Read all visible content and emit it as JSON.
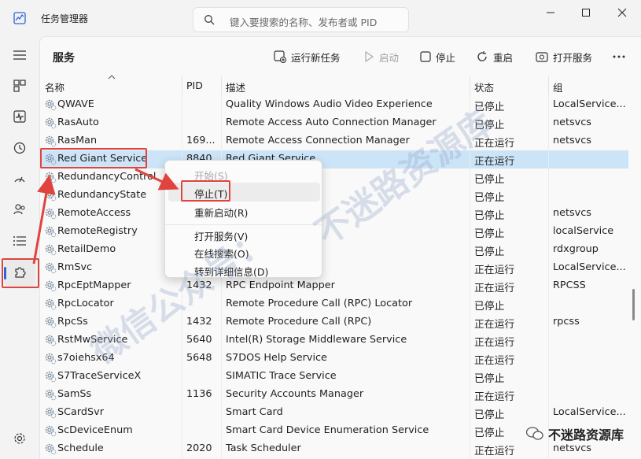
{
  "window": {
    "title": "任务管理器",
    "search_placeholder": "键入要搜索的名称、发布者或 PID"
  },
  "toolbar": {
    "page_title": "服务",
    "run_new_task": "运行新任务",
    "start": "启动",
    "stop": "停止",
    "restart": "重启",
    "open_services": "打开服务"
  },
  "columns": {
    "name": "名称",
    "pid": "PID",
    "description": "描述",
    "status": "状态",
    "group": "组"
  },
  "rows": [
    {
      "name": "QWAVE",
      "pid": "",
      "desc": "Quality Windows Audio Video Experience",
      "status": "已停止",
      "group": "LocalService..."
    },
    {
      "name": "RasAuto",
      "pid": "",
      "desc": "Remote Access Auto Connection Manager",
      "status": "已停止",
      "group": "netsvcs"
    },
    {
      "name": "RasMan",
      "pid": "169...",
      "desc": "Remote Access Connection Manager",
      "status": "正在运行",
      "group": "netsvcs"
    },
    {
      "name": "Red Giant Service",
      "pid": "8840",
      "desc": "Red Giant Service",
      "status": "正在运行",
      "group": ""
    },
    {
      "name": "RedundancyControl",
      "pid": "",
      "desc": "",
      "status": "已停止",
      "group": ""
    },
    {
      "name": "RedundancyState",
      "pid": "",
      "desc": "",
      "status": "已停止",
      "group": ""
    },
    {
      "name": "RemoteAccess",
      "pid": "",
      "desc": "e Access",
      "status": "已停止",
      "group": "netsvcs"
    },
    {
      "name": "RemoteRegistry",
      "pid": "",
      "desc": "",
      "status": "已停止",
      "group": "localService"
    },
    {
      "name": "RetailDemo",
      "pid": "",
      "desc": "",
      "status": "已停止",
      "group": "rdxgroup"
    },
    {
      "name": "RmSvc",
      "pid": "",
      "desc": "",
      "status": "正在运行",
      "group": "LocalService..."
    },
    {
      "name": "RpcEptMapper",
      "pid": "1432",
      "desc": "RPC Endpoint Mapper",
      "status": "正在运行",
      "group": "RPCSS"
    },
    {
      "name": "RpcLocator",
      "pid": "",
      "desc": "Remote Procedure Call (RPC) Locator",
      "status": "已停止",
      "group": ""
    },
    {
      "name": "RpcSs",
      "pid": "1432",
      "desc": "Remote Procedure Call (RPC)",
      "status": "正在运行",
      "group": "rpcss"
    },
    {
      "name": "RstMwService",
      "pid": "5640",
      "desc": "Intel(R) Storage Middleware Service",
      "status": "正在运行",
      "group": ""
    },
    {
      "name": "s7oiehsx64",
      "pid": "5648",
      "desc": "S7DOS Help Service",
      "status": "正在运行",
      "group": ""
    },
    {
      "name": "S7TraceServiceX",
      "pid": "",
      "desc": "SIMATIC Trace Service",
      "status": "已停止",
      "group": ""
    },
    {
      "name": "SamSs",
      "pid": "1136",
      "desc": "Security Accounts Manager",
      "status": "正在运行",
      "group": ""
    },
    {
      "name": "SCardSvr",
      "pid": "",
      "desc": "Smart Card",
      "status": "已停止",
      "group": "LocalService..."
    },
    {
      "name": "ScDeviceEnum",
      "pid": "",
      "desc": "Smart Card Device Enumeration Service",
      "status": "已停止",
      "group": ""
    },
    {
      "name": "Schedule",
      "pid": "2020",
      "desc": "Task Scheduler",
      "status": "正在运行",
      "group": "netsvcs"
    }
  ],
  "context_menu": {
    "start": "开始(S)",
    "stop": "停止(T)",
    "restart": "重新启动(R)",
    "open_services": "打开服务(V)",
    "search_online": "在线搜索(O)",
    "go_to_details": "转到详细信息(D)"
  },
  "watermark": {
    "text1": "微信公众号：",
    "text2": "不迷路资源库",
    "credit": "不迷路资源库"
  },
  "colors": {
    "accent": "#2f64d6",
    "selection": "#cce4f7",
    "annotation_red": "#e0443e"
  }
}
